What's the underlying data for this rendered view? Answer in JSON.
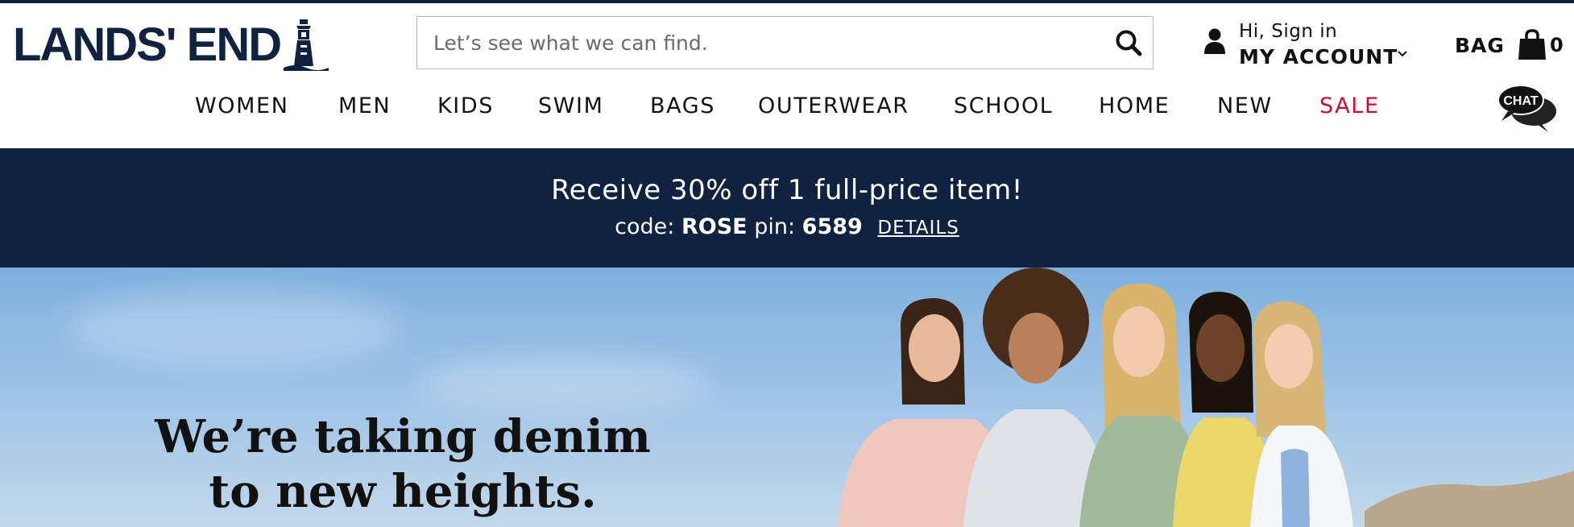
{
  "brand": {
    "name": "LANDS' END"
  },
  "search": {
    "placeholder": "Let’s see what we can find."
  },
  "account": {
    "greeting": "Hi, Sign in",
    "label": "MY ACCOUNT"
  },
  "bag": {
    "label": "BAG",
    "count": "0"
  },
  "nav": {
    "items": [
      "WOMEN",
      "MEN",
      "KIDS",
      "SWIM",
      "BAGS",
      "OUTERWEAR",
      "SCHOOL",
      "HOME",
      "NEW",
      "SALE"
    ]
  },
  "chat": {
    "label": "CHAT"
  },
  "promo": {
    "headline": "Receive 30% off 1 full-price item!",
    "code_label": "code:",
    "code": "ROSE",
    "pin_label": "pin:",
    "pin": "6589",
    "details": "DETAILS"
  },
  "hero": {
    "title_line1": "We’re taking denim",
    "title_line2": "to new heights."
  },
  "colors": {
    "navy": "#0f2240",
    "sale_red": "#c8102e"
  },
  "icons": [
    "lighthouse-icon",
    "search-icon",
    "user-icon",
    "chevron-down-icon",
    "shopping-bag-icon",
    "chat-bubble-icon"
  ]
}
